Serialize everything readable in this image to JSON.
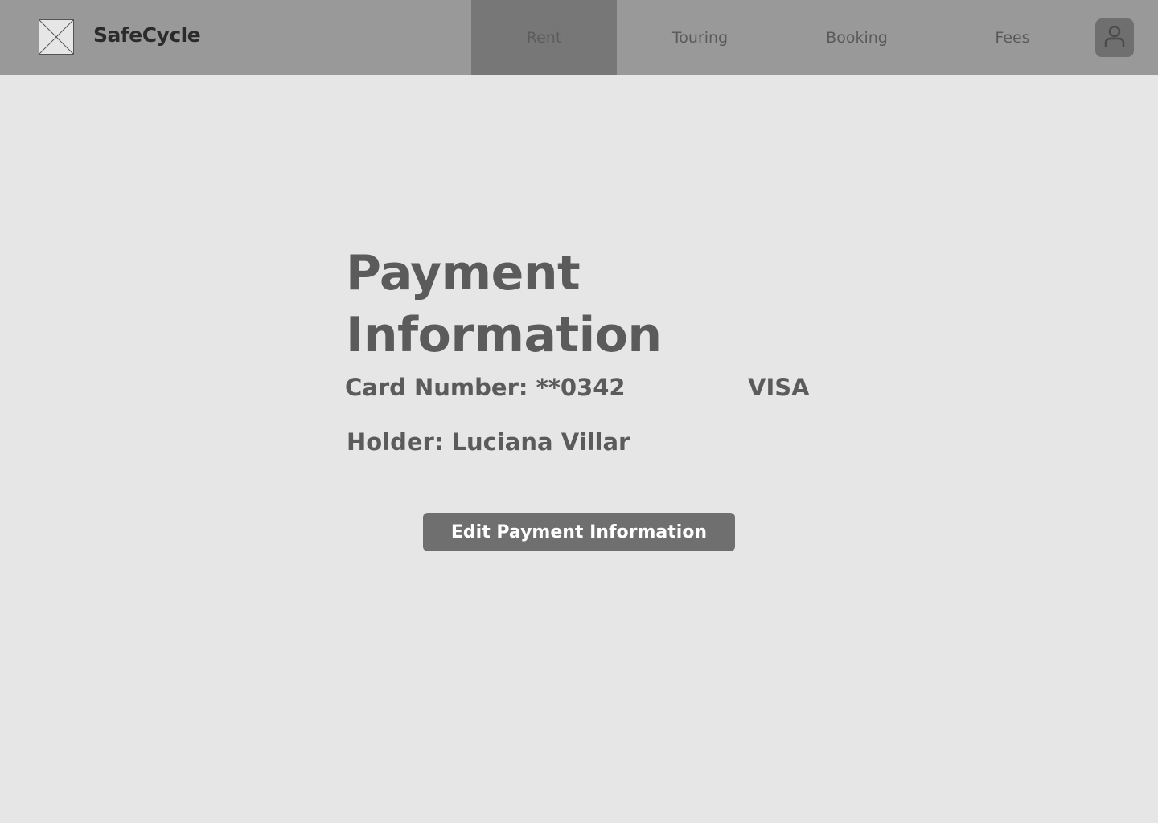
{
  "header": {
    "logo_icon": "image-placeholder-icon",
    "brand": "SafeCycle",
    "nav": [
      {
        "label": "Rent",
        "active": true
      },
      {
        "label": "Touring",
        "active": false
      },
      {
        "label": "Booking",
        "active": false
      },
      {
        "label": "Fees",
        "active": false
      }
    ],
    "profile_icon": "user-icon"
  },
  "main": {
    "title": "Payment Information",
    "card_number": "Card Number: **0342",
    "card_brand": "VISA",
    "holder": "Holder: Luciana Villar",
    "edit_button_label": "Edit Payment Information"
  },
  "colors": {
    "background": "#e6e6e6",
    "header": "#999999",
    "active_tab": "#777777",
    "button": "#6f6f6f",
    "text": "#5b5b5b"
  }
}
